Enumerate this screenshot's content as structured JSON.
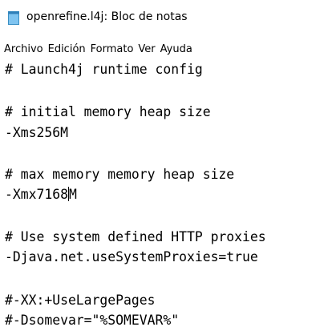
{
  "window": {
    "title": "openrefine.l4j: Bloc de notas",
    "icon": "notepad-icon"
  },
  "menu": {
    "items": [
      "Archivo",
      "Edición",
      "Formato",
      "Ver",
      "Ayuda"
    ]
  },
  "editor": {
    "lines": [
      "# Launch4j runtime config",
      "",
      "# initial memory heap size",
      "-Xms256M",
      "",
      "# max memory memory heap size",
      "-Xmx7168M",
      "",
      "# Use system defined HTTP proxies",
      "-Djava.net.useSystemProxies=true",
      "",
      "#-XX:+UseLargePages",
      "#-Dsomevar=\"%SOMEVAR%\""
    ],
    "caret_line": 6,
    "caret_column": 8
  }
}
